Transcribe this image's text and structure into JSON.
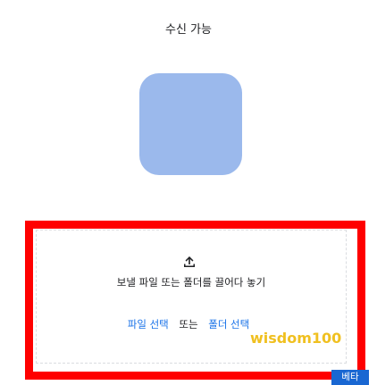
{
  "status": {
    "title": "수신 가능"
  },
  "avatar": {
    "color": "#9bb9ec"
  },
  "dropzone": {
    "icon": "upload-icon",
    "instruction": "보낼 파일 또는 폴더를 끌어다 놓기",
    "select_file_label": "파일 선택",
    "or_label": "또는",
    "select_folder_label": "폴더 선택"
  },
  "watermark": {
    "text": "wisdom100"
  },
  "badge": {
    "label": "베타"
  },
  "colors": {
    "highlight": "#ff0000",
    "link": "#1a73e8",
    "badge_bg": "#1967d2"
  }
}
